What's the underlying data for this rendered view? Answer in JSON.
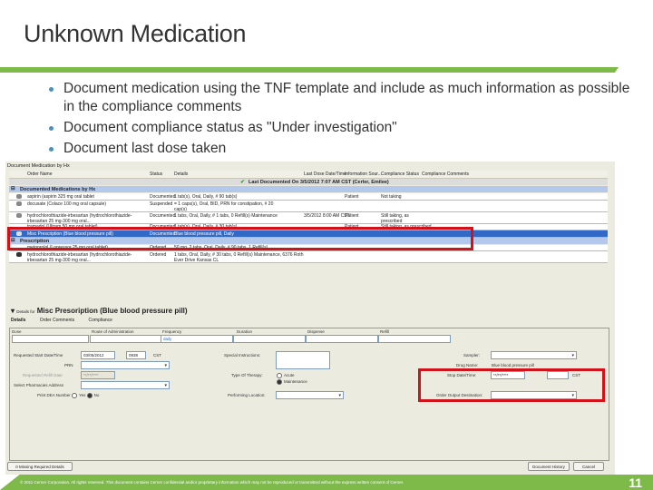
{
  "slide": {
    "title": "Unknown Medication",
    "bullets": [
      "Document medication using the TNF template and include as much information as possible in the compliance comments",
      "Document compliance status as \"Under investigation\"",
      "Document last dose taken"
    ],
    "page_number": "11",
    "footer": "© 2011 Cerner Corporation. All rights reserved. This document contains Cerner confidential and/or proprietary information which may not be reproduced or transmitted without the express written consent of Cerner."
  },
  "app": {
    "title": "Document Medication by Hx",
    "columns": [
      "Order Name",
      "Status",
      "Details",
      "Last Dose Date/Time",
      "Information Sour...",
      "Compliance Status",
      "Compliance Comments"
    ],
    "last_documented": "Last Documented On 3/5/2012 7:07 AM CST (Cerler, Emilee)",
    "group_documented": "Documented Medications by Hx",
    "group_prescription": "Prescription",
    "rows": [
      {
        "name": "aspirin (aspirin 325 mg oral tablet",
        "status": "Documented",
        "details": "1 tab(s), Oral, Daily, # 90 tab(s)",
        "last_dose": "",
        "source": "Patient",
        "compliance": "Not taking"
      },
      {
        "name": "docusate (Colace 100 mg oral capsule)",
        "status": "Suspended",
        "details": "= 1 caps(s), Oral, BID, PRN for constipation, # 20 cap(s)",
        "last_dose": "",
        "source": "",
        "compliance": ""
      },
      {
        "name": "hydrochlorothiazide-irbesartan (hydrochlorothiazide-irbesartan 25 mg-300 mg oral...",
        "status": "Documented",
        "details": "1 tabs, Oral, Daily, # 1 tabs, 0 Refill(s) Maintenance",
        "last_dose": "3/5/2012 8:00 AM CST",
        "source": "Patient",
        "compliance": "Still taking, as prescribed"
      },
      {
        "name": "tramadol (Ultram 50 mg oral tablet)",
        "status": "Documented",
        "details": "1 tab(s), Oral, Daily, # 30 tab(s)",
        "last_dose": "",
        "source": "Patient",
        "compliance": "Still taking, as prescribed"
      },
      {
        "name": "Misc Prescription (Blue blood pressure pill)",
        "status": "Documented",
        "details": "Blue blood pressure pill, Daily",
        "last_dose": "",
        "source": "",
        "compliance": ""
      },
      {
        "name": "metoprolol (Lopressor 25 mg oral tablet)",
        "status": "Ordered",
        "details": "50 mg, 2 tabs, Oral, Daily, # 90 tabs, 1 Refill(s)",
        "last_dose": "",
        "source": "",
        "compliance": ""
      },
      {
        "name": "hydrochlorothiazide-irbesartan (hydrochlorothiazide-irbesartan 25 mg-300 mg oral...",
        "status": "Ordered",
        "details": "1 tabs, Oral, Daily, # 30 tabs, 0 Refill(s) Maintenance, 6376 Roth Ever Drive Kansas CL",
        "last_dose": "",
        "source": "",
        "compliance": ""
      }
    ],
    "details": {
      "prefix": "Details for",
      "title": "Misc Presoription (Blue blood pressure pill)",
      "tabs": [
        "Details",
        "Order Comments",
        "Compliance"
      ],
      "fields": {
        "dose_label": "Dose",
        "route_label": "Route of Administration",
        "frequency_label": "Frequency",
        "frequency_value": "daily",
        "duration_label": "Duration",
        "dispense_label": "Dispense",
        "refill_label": "Refill",
        "start_label": "Requested Start Date/Time",
        "start_date": "03/05/2012",
        "start_time": "0938",
        "tz": "CST",
        "prn_label": "PRN",
        "refill_date_label": "Requested Refill Date",
        "refill_date": "**/**/****",
        "pharmacy_label": "Select Pharmacies Address",
        "dea_label": "Print DEA Number",
        "yes": "Yes",
        "no": "No",
        "special_label": "Special Instructions:",
        "therapy_label": "Type Of Therapy:",
        "acute": "Acute",
        "maintenance": "Maintenance",
        "performing_label": "Performing Location:",
        "sampler_label": "Sampler:",
        "drug_name_label": "Drug Name:",
        "drug_name": "Blue blood pressure pill",
        "stop_label": "Stop Date/Time:",
        "stop_date": "**/**/****",
        "order_output_label": "Order Output Destination:"
      }
    },
    "buttons": {
      "view_required": "0 Missing Required Details",
      "document_history": "Document History",
      "cancel": "Cancel"
    }
  }
}
